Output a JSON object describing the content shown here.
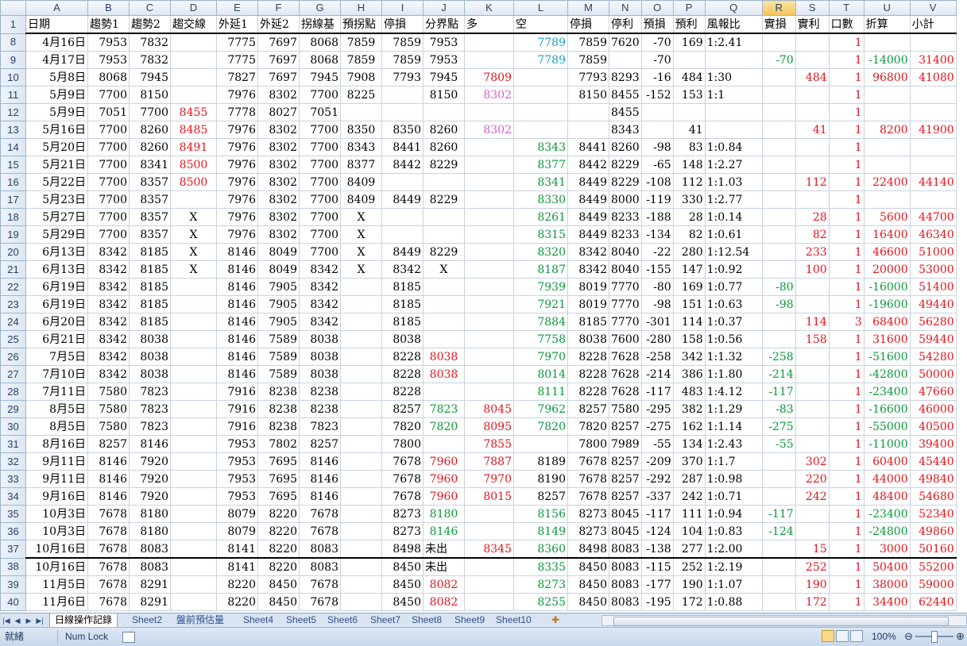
{
  "columns": [
    "A",
    "B",
    "C",
    "D",
    "E",
    "F",
    "G",
    "H",
    "I",
    "J",
    "K",
    "L",
    "M",
    "N",
    "O",
    "P",
    "Q",
    "R",
    "S",
    "T",
    "U",
    "V"
  ],
  "selected_column": "R",
  "header_row": {
    "row_num": "1",
    "cells": [
      "日期",
      "趨勢1",
      "趨勢2",
      "趨交線",
      "外延1",
      "外延2",
      "拐線基",
      "預拐點",
      "停損",
      "分界點",
      "多",
      "空",
      "停損",
      "停利",
      "預損",
      "預利",
      "風報比",
      "實損",
      "實利",
      "口數",
      "折算",
      "小計"
    ]
  },
  "rows": [
    {
      "n": "8",
      "c": [
        "4月16日",
        "7953",
        "7832",
        "",
        "7775",
        "7697",
        "8068",
        "7859",
        "7859",
        "7953",
        "",
        "7789",
        "7859",
        "7620",
        "-70",
        "169",
        "1:2.41",
        "",
        "",
        "1",
        "",
        ""
      ]
    },
    {
      "n": "9",
      "c": [
        "4月17日",
        "7953",
        "7832",
        "",
        "7775",
        "7697",
        "8068",
        "7859",
        "7859",
        "7953",
        "",
        "7789",
        "7859",
        "",
        "-70",
        "",
        "",
        "-70",
        "",
        "1",
        "-14000",
        "31400"
      ]
    },
    {
      "n": "10",
      "c": [
        "5月8日",
        "8068",
        "7945",
        "",
        "7827",
        "7697",
        "7945",
        "7908",
        "7793",
        "7945",
        "7809",
        "",
        "7793",
        "8293",
        "-16",
        "484",
        "1:30",
        "",
        "484",
        "1",
        "96800",
        "41080"
      ]
    },
    {
      "n": "11",
      "c": [
        "5月9日",
        "7700",
        "8150",
        "",
        "7976",
        "8302",
        "7700",
        "8225",
        "",
        "8150",
        "8302",
        "",
        "8150",
        "8455",
        "-152",
        "153",
        "1:1",
        "",
        "",
        "1",
        "",
        ""
      ]
    },
    {
      "n": "12",
      "c": [
        "5月9日",
        "7051",
        "7700",
        "8455",
        "7778",
        "8027",
        "7051",
        "",
        "",
        "",
        "",
        "",
        "",
        "8455",
        "",
        "",
        "",
        "",
        "",
        "1",
        "",
        ""
      ]
    },
    {
      "n": "13",
      "c": [
        "5月16日",
        "7700",
        "8260",
        "8485",
        "7976",
        "8302",
        "7700",
        "8350",
        "8350",
        "8260",
        "8302",
        "",
        "",
        "8343",
        "",
        "41",
        "",
        "",
        "41",
        "1",
        "8200",
        "41900"
      ]
    },
    {
      "n": "14",
      "c": [
        "5月20日",
        "7700",
        "8260",
        "8491",
        "7976",
        "8302",
        "7700",
        "8343",
        "8441",
        "8260",
        "",
        "8343",
        "8441",
        "8260",
        "-98",
        "83",
        "1:0.84",
        "",
        "",
        "1",
        "",
        ""
      ]
    },
    {
      "n": "15",
      "c": [
        "5月21日",
        "7700",
        "8341",
        "8500",
        "7976",
        "8302",
        "7700",
        "8377",
        "8442",
        "8229",
        "",
        "8377",
        "8442",
        "8229",
        "-65",
        "148",
        "1:2.27",
        "",
        "",
        "1",
        "",
        ""
      ]
    },
    {
      "n": "16",
      "c": [
        "5月22日",
        "7700",
        "8357",
        "8500",
        "7976",
        "8302",
        "7700",
        "8409",
        "",
        "",
        "",
        "8341",
        "8449",
        "8229",
        "-108",
        "112",
        "1:1.03",
        "",
        "112",
        "1",
        "22400",
        "44140"
      ]
    },
    {
      "n": "17",
      "c": [
        "5月23日",
        "7700",
        "8357",
        "",
        "7976",
        "8302",
        "7700",
        "8409",
        "8449",
        "8229",
        "",
        "8330",
        "8449",
        "8000",
        "-119",
        "330",
        "1:2.77",
        "",
        "",
        "1",
        "",
        ""
      ]
    },
    {
      "n": "18",
      "c": [
        "5月27日",
        "7700",
        "8357",
        "X",
        "7976",
        "8302",
        "7700",
        "X",
        "",
        "",
        "",
        "8261",
        "8449",
        "8233",
        "-188",
        "28",
        "1:0.14",
        "",
        "28",
        "1",
        "5600",
        "44700"
      ]
    },
    {
      "n": "19",
      "c": [
        "5月29日",
        "7700",
        "8357",
        "X",
        "7976",
        "8302",
        "7700",
        "X",
        "",
        "",
        "",
        "8315",
        "8449",
        "8233",
        "-134",
        "82",
        "1:0.61",
        "",
        "82",
        "1",
        "16400",
        "46340"
      ]
    },
    {
      "n": "20",
      "c": [
        "6月13日",
        "8342",
        "8185",
        "X",
        "8146",
        "8049",
        "7700",
        "X",
        "8449",
        "8229",
        "",
        "8320",
        "8342",
        "8040",
        "-22",
        "280",
        "1:12.54",
        "",
        "233",
        "1",
        "46600",
        "51000"
      ]
    },
    {
      "n": "21",
      "c": [
        "6月13日",
        "8342",
        "8185",
        "X",
        "8146",
        "8049",
        "8342",
        "X",
        "8342",
        "X",
        "",
        "8187",
        "8342",
        "8040",
        "-155",
        "147",
        "1:0.92",
        "",
        "100",
        "1",
        "20000",
        "53000"
      ]
    },
    {
      "n": "22",
      "c": [
        "6月19日",
        "8342",
        "8185",
        "",
        "8146",
        "7905",
        "8342",
        "",
        "8185",
        "",
        "",
        "7939",
        "8019",
        "7770",
        "-80",
        "169",
        "1:0.77",
        "-80",
        "",
        "1",
        "-16000",
        "51400"
      ]
    },
    {
      "n": "23",
      "c": [
        "6月19日",
        "8342",
        "8185",
        "",
        "8146",
        "7905",
        "8342",
        "",
        "8185",
        "",
        "",
        "7921",
        "8019",
        "7770",
        "-98",
        "151",
        "1:0.63",
        "-98",
        "",
        "1",
        "-19600",
        "49440"
      ]
    },
    {
      "n": "24",
      "c": [
        "6月20日",
        "8342",
        "8185",
        "",
        "8146",
        "7905",
        "8342",
        "",
        "8185",
        "",
        "",
        "7884",
        "8185",
        "7770",
        "-301",
        "114",
        "1:0.37",
        "",
        "114",
        "3",
        "68400",
        "56280"
      ]
    },
    {
      "n": "25",
      "c": [
        "6月21日",
        "8342",
        "8038",
        "",
        "8146",
        "7589",
        "8038",
        "",
        "8038",
        "",
        "",
        "7758",
        "8038",
        "7600",
        "-280",
        "158",
        "1:0.56",
        "",
        "158",
        "1",
        "31600",
        "59440"
      ]
    },
    {
      "n": "26",
      "c": [
        "7月5日",
        "8342",
        "8038",
        "",
        "8146",
        "7589",
        "8038",
        "",
        "8228",
        "8038",
        "",
        "7970",
        "8228",
        "7628",
        "-258",
        "342",
        "1:1.32",
        "-258",
        "",
        "1",
        "-51600",
        "54280"
      ]
    },
    {
      "n": "27",
      "c": [
        "7月10日",
        "8342",
        "8038",
        "",
        "8146",
        "7589",
        "8038",
        "",
        "8228",
        "8038",
        "",
        "8014",
        "8228",
        "7628",
        "-214",
        "386",
        "1:1.80",
        "-214",
        "",
        "1",
        "-42800",
        "50000"
      ]
    },
    {
      "n": "28",
      "c": [
        "7月11日",
        "7580",
        "7823",
        "",
        "7916",
        "8238",
        "8238",
        "",
        "8228",
        "",
        "",
        "8111",
        "8228",
        "7628",
        "-117",
        "483",
        "1:4.12",
        "-117",
        "",
        "1",
        "-23400",
        "47660"
      ]
    },
    {
      "n": "29",
      "c": [
        "8月5日",
        "7580",
        "7823",
        "",
        "7916",
        "8238",
        "8238",
        "",
        "8257",
        "7823",
        "8045",
        "7962",
        "8257",
        "7580",
        "-295",
        "382",
        "1:1.29",
        "-83",
        "",
        "1",
        "-16600",
        "46000"
      ]
    },
    {
      "n": "30",
      "c": [
        "8月5日",
        "7580",
        "7823",
        "",
        "7916",
        "8238",
        "7823",
        "",
        "7820",
        "7820",
        "8095",
        "7820",
        "7820",
        "8257",
        "-275",
        "162",
        "1:1.14",
        "-275",
        "",
        "1",
        "-55000",
        "40500"
      ]
    },
    {
      "n": "31",
      "c": [
        "8月16日",
        "8257",
        "8146",
        "",
        "7953",
        "7802",
        "8257",
        "",
        "7800",
        "",
        "7855",
        "",
        "7800",
        "7989",
        "-55",
        "134",
        "1:2.43",
        "-55",
        "",
        "1",
        "-11000",
        "39400"
      ]
    },
    {
      "n": "32",
      "c": [
        "9月11日",
        "8146",
        "7920",
        "",
        "7953",
        "7695",
        "8146",
        "",
        "7678",
        "7960",
        "7887",
        "8189",
        "7678",
        "8257",
        "-209",
        "370",
        "1:1.7",
        "",
        "302",
        "1",
        "60400",
        "45440"
      ]
    },
    {
      "n": "33",
      "c": [
        "9月11日",
        "8146",
        "7920",
        "",
        "7953",
        "7695",
        "8146",
        "",
        "7678",
        "7960",
        "7970",
        "8190",
        "7678",
        "8257",
        "-292",
        "287",
        "1:0.98",
        "",
        "220",
        "1",
        "44000",
        "49840"
      ]
    },
    {
      "n": "34",
      "c": [
        "9月16日",
        "8146",
        "7920",
        "",
        "7953",
        "7695",
        "8146",
        "",
        "7678",
        "7960",
        "8015",
        "8257",
        "7678",
        "8257",
        "-337",
        "242",
        "1:0.71",
        "",
        "242",
        "1",
        "48400",
        "54680"
      ]
    },
    {
      "n": "35",
      "c": [
        "10月3日",
        "7678",
        "8180",
        "",
        "8079",
        "8220",
        "7678",
        "",
        "8273",
        "8180",
        "",
        "8156",
        "8273",
        "8045",
        "-117",
        "111",
        "1:0.94",
        "-117",
        "",
        "1",
        "-23400",
        "52340"
      ]
    },
    {
      "n": "36",
      "c": [
        "10月3日",
        "7678",
        "8180",
        "",
        "8079",
        "8220",
        "7678",
        "",
        "8273",
        "8146",
        "",
        "8149",
        "8273",
        "8045",
        "-124",
        "104",
        "1:0.83",
        "-124",
        "",
        "1",
        "-24800",
        "49860"
      ]
    },
    {
      "n": "37",
      "c": [
        "10月16日",
        "7678",
        "8083",
        "",
        "8141",
        "8220",
        "8083",
        "",
        "8498",
        "未出",
        "8345",
        "8360",
        "8498",
        "8083",
        "-138",
        "277",
        "1:2.00",
        "",
        "15",
        "1",
        "3000",
        "50160"
      ]
    },
    {
      "n": "38",
      "c": [
        "10月16日",
        "7678",
        "8083",
        "",
        "8141",
        "8220",
        "8083",
        "",
        "8450",
        "未出",
        "",
        "8335",
        "8450",
        "8083",
        "-115",
        "252",
        "1:2.19",
        "",
        "252",
        "1",
        "50400",
        "55200"
      ]
    },
    {
      "n": "39",
      "c": [
        "11月5日",
        "7678",
        "8291",
        "",
        "8220",
        "8450",
        "7678",
        "",
        "8450",
        "8082",
        "",
        "8273",
        "8450",
        "8083",
        "-177",
        "190",
        "1:1.07",
        "",
        "190",
        "1",
        "38000",
        "59000"
      ]
    },
    {
      "n": "40",
      "c": [
        "11月6日",
        "7678",
        "8291",
        "",
        "8220",
        "8450",
        "7678",
        "",
        "8450",
        "8082",
        "",
        "8255",
        "8450",
        "8083",
        "-195",
        "172",
        "1:0.88",
        "",
        "172",
        "1",
        "34400",
        "62440"
      ]
    }
  ],
  "sheet_tabs": [
    "日線操作記錄",
    "Sheet2",
    "盤前預估量",
    "Sheet4",
    "Sheet5",
    "Sheet6",
    "Sheet7",
    "Sheet8",
    "Sheet9",
    "Sheet10"
  ],
  "active_tab": "日線操作記錄",
  "status": {
    "ready": "就緒",
    "numlock": "Num Lock",
    "zoom": "100%"
  },
  "colors": {
    "red": "#e8141b",
    "green": "#0a9a3a",
    "cyan": "#1aa3c4",
    "pink": "#d35fd3",
    "selected_header": "#f3c35a"
  }
}
